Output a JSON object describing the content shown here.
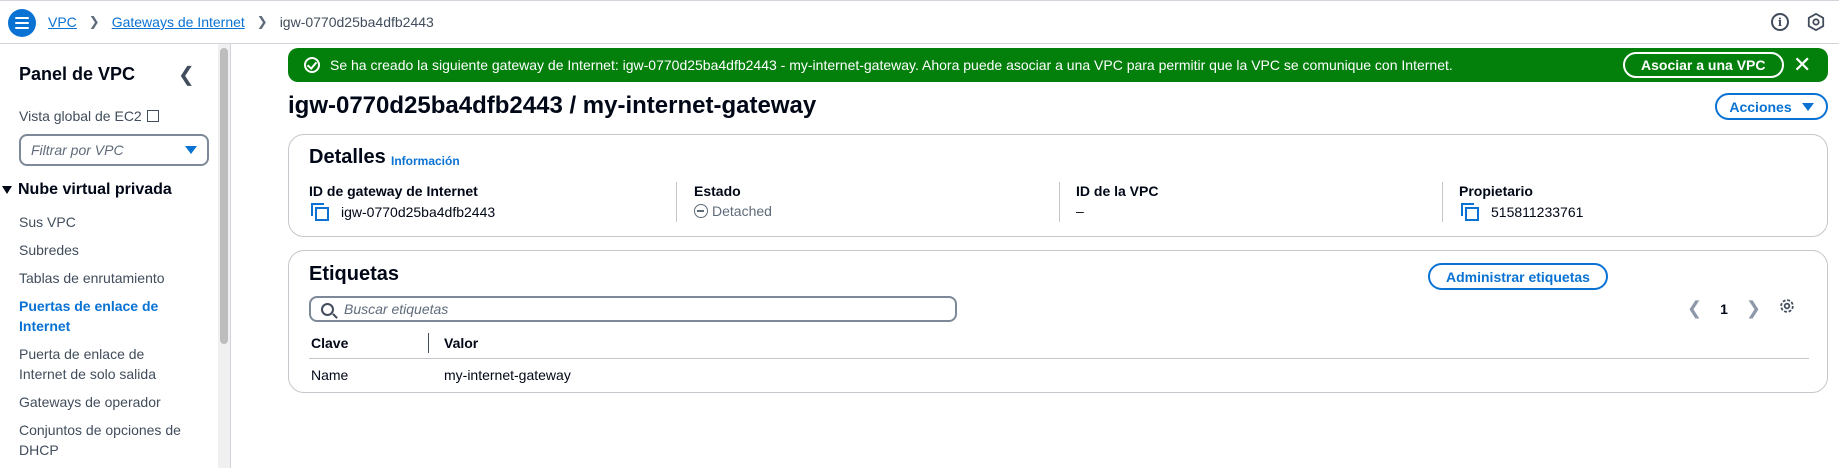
{
  "breadcrumb": {
    "items": [
      "VPC",
      "Gateways de Internet"
    ],
    "current": "igw-0770d25ba4dfb2443"
  },
  "topbar": {
    "icons": [
      "info-icon",
      "hexagon-settings-icon"
    ]
  },
  "sidebar": {
    "title": "Panel de VPC",
    "global_view": "Vista global de EC2",
    "filter_placeholder": "Filtrar por VPC",
    "section": "Nube virtual privada",
    "items": [
      {
        "label": "Sus VPC"
      },
      {
        "label": "Subredes"
      },
      {
        "label": "Tablas de enrutamiento"
      },
      {
        "label": "Puertas de enlace de Internet"
      },
      {
        "label": "Puerta de enlace de Internet de solo salida"
      },
      {
        "label": "Gateways de operador"
      },
      {
        "label": "Conjuntos de opciones de DHCP"
      }
    ],
    "active_item": "Puertas de enlace de Internet"
  },
  "flash": {
    "message": "Se ha creado la siguiente gateway de Internet: igw-0770d25ba4dfb2443 - my-internet-gateway. Ahora puede asociar a una VPC para permitir que la VPC se comunique con Internet.",
    "button": "Asociar a una VPC",
    "color": "#037f0c"
  },
  "page": {
    "title": "igw-0770d25ba4dfb2443 / my-internet-gateway",
    "actions": "Acciones"
  },
  "details": {
    "heading": "Detalles",
    "info": "Información",
    "fields": [
      {
        "label": "ID de gateway de Internet",
        "value": "igw-0770d25ba4dfb2443"
      },
      {
        "label": "Estado",
        "value": "Detached"
      },
      {
        "label": "ID de la VPC",
        "value": "–"
      },
      {
        "label": "Propietario",
        "value": "515811233761"
      }
    ]
  },
  "tags": {
    "heading": "Etiquetas",
    "manage": "Administrar etiquetas",
    "search_placeholder": "Buscar etiquetas",
    "page": "1",
    "columns": [
      "Clave",
      "Valor"
    ],
    "rows": [
      {
        "key": "Name",
        "value": "my-internet-gateway"
      }
    ]
  },
  "colors": {
    "accent": "#0972d3",
    "success": "#037f0c"
  }
}
